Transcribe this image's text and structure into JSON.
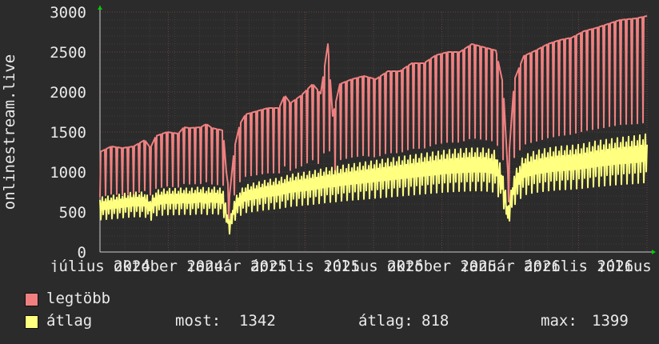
{
  "chart_data": {
    "type": "line",
    "ylabel": "onlinestream.live",
    "ylim": [
      0,
      3000
    ],
    "y_ticks": [
      0,
      500,
      1000,
      1500,
      2000,
      2500,
      3000
    ],
    "x_tick_labels": [
      "július 2024",
      "október 2024",
      "január 2025",
      "április 2025",
      "július 2025",
      "október 2025",
      "január 2026",
      "április 2026",
      "július 2026"
    ],
    "grid": true,
    "legend_placement": "bottom",
    "series": [
      {
        "name": "legtöbb",
        "color": "#f08080",
        "points": [
          [
            0,
            1250
          ],
          [
            14,
            1320
          ],
          [
            28,
            1300
          ],
          [
            42,
            1320
          ],
          [
            56,
            1400
          ],
          [
            63,
            1300
          ],
          [
            70,
            1450
          ],
          [
            84,
            1500
          ],
          [
            98,
            1480
          ],
          [
            105,
            1560
          ],
          [
            112,
            1550
          ],
          [
            126,
            1560
          ],
          [
            133,
            1600
          ],
          [
            140,
            1550
          ],
          [
            154,
            1520
          ],
          [
            158,
            1000
          ],
          [
            162,
            700
          ],
          [
            168,
            1300
          ],
          [
            175,
            1600
          ],
          [
            182,
            1720
          ],
          [
            196,
            1760
          ],
          [
            210,
            1800
          ],
          [
            224,
            1800
          ],
          [
            231,
            1960
          ],
          [
            238,
            1860
          ],
          [
            252,
            1960
          ],
          [
            266,
            2100
          ],
          [
            276,
            1980
          ],
          [
            285,
            2600
          ],
          [
            291,
            1700
          ],
          [
            300,
            2100
          ],
          [
            315,
            2160
          ],
          [
            330,
            2200
          ],
          [
            345,
            2160
          ],
          [
            360,
            2260
          ],
          [
            375,
            2260
          ],
          [
            390,
            2360
          ],
          [
            405,
            2360
          ],
          [
            420,
            2460
          ],
          [
            435,
            2500
          ],
          [
            450,
            2500
          ],
          [
            465,
            2600
          ],
          [
            480,
            2560
          ],
          [
            495,
            2520
          ],
          [
            504,
            2100
          ],
          [
            510,
            1000
          ],
          [
            518,
            2150
          ],
          [
            530,
            2450
          ],
          [
            545,
            2520
          ],
          [
            560,
            2600
          ],
          [
            575,
            2650
          ],
          [
            590,
            2680
          ],
          [
            605,
            2760
          ],
          [
            620,
            2800
          ],
          [
            635,
            2850
          ],
          [
            650,
            2900
          ],
          [
            670,
            2920
          ],
          [
            684,
            2950
          ]
        ]
      },
      {
        "name": "átlag",
        "color": "#ffff80",
        "points": [
          [
            0,
            620
          ],
          [
            14,
            640
          ],
          [
            28,
            660
          ],
          [
            42,
            680
          ],
          [
            56,
            680
          ],
          [
            63,
            600
          ],
          [
            70,
            700
          ],
          [
            84,
            720
          ],
          [
            98,
            720
          ],
          [
            105,
            730
          ],
          [
            112,
            720
          ],
          [
            126,
            740
          ],
          [
            133,
            720
          ],
          [
            140,
            740
          ],
          [
            154,
            720
          ],
          [
            158,
            500
          ],
          [
            162,
            350
          ],
          [
            168,
            600
          ],
          [
            175,
            700
          ],
          [
            182,
            760
          ],
          [
            196,
            790
          ],
          [
            210,
            820
          ],
          [
            224,
            840
          ],
          [
            231,
            860
          ],
          [
            238,
            880
          ],
          [
            252,
            900
          ],
          [
            266,
            920
          ],
          [
            276,
            940
          ],
          [
            285,
            960
          ],
          [
            291,
            960
          ],
          [
            300,
            980
          ],
          [
            315,
            1000
          ],
          [
            330,
            1020
          ],
          [
            345,
            1040
          ],
          [
            360,
            1060
          ],
          [
            375,
            1080
          ],
          [
            390,
            1100
          ],
          [
            405,
            1120
          ],
          [
            420,
            1140
          ],
          [
            435,
            1160
          ],
          [
            450,
            1170
          ],
          [
            465,
            1180
          ],
          [
            480,
            1180
          ],
          [
            495,
            1150
          ],
          [
            504,
            900
          ],
          [
            510,
            500
          ],
          [
            518,
            900
          ],
          [
            530,
            1100
          ],
          [
            545,
            1150
          ],
          [
            560,
            1180
          ],
          [
            575,
            1200
          ],
          [
            590,
            1210
          ],
          [
            605,
            1230
          ],
          [
            620,
            1260
          ],
          [
            635,
            1280
          ],
          [
            650,
            1300
          ],
          [
            670,
            1320
          ],
          [
            684,
            1342
          ]
        ]
      }
    ]
  },
  "legend": [
    {
      "label": "legtöbb",
      "color": "#f08080"
    },
    {
      "label": "átlag",
      "color": "#ffff80"
    }
  ],
  "stats": {
    "now_label": "most:",
    "now_value": "1342",
    "avg_label": "átlag:",
    "avg_value": "818",
    "max_label": "max:",
    "max_value": "1399"
  }
}
